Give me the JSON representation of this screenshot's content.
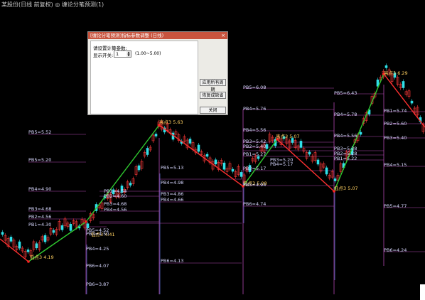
{
  "titlebar": {
    "text": "某股份(日线 前复权) ◎ 缠论分笔预测(1)"
  },
  "dialog": {
    "title": "[缠论分笔预测]指标参数调整 (日线)",
    "close": "×",
    "heading": "请设置计算参数:",
    "param_label": "显示开关:",
    "param_value": "1",
    "param_range": "(1.00~5.00)",
    "apply_all": "应用所有周期",
    "restore_default": "恢复成缺省",
    "close_button": "关闭"
  },
  "colors": {
    "up": "#ff3a3a",
    "down": "#2fe0e8",
    "up_leg": "#2fc82f",
    "down_leg": "#ff3030",
    "label": "#d8d8ff",
    "purple": "#b048b0",
    "dotted": "#b0b0ff",
    "point": "#ff2020"
  },
  "chart": {
    "turning_points": [
      {
        "text": "低点3 4.19"
      },
      {
        "text": "低点3 4.41"
      },
      {
        "text": "高点3 5.63"
      },
      {
        "text": "低点3 5.08"
      },
      {
        "text": "高点3 5.07"
      },
      {
        "text": "低点3 5.07"
      },
      {
        "text": "高点3 6.29"
      }
    ],
    "levels": [
      {
        "text": "PB5=5.52"
      },
      {
        "text": "PB5=5.20"
      },
      {
        "text": "PB4=4.90"
      },
      {
        "text": "PB3=4.68"
      },
      {
        "text": "PB2=4.56"
      },
      {
        "text": "PB1=4.30"
      },
      {
        "text": "PB4=4.25"
      },
      {
        "text": "PB6=4.07"
      },
      {
        "text": "PB6=3.87"
      },
      {
        "text": "PB1=4.54"
      },
      {
        "text": "PB2=4.60"
      },
      {
        "text": "PB3=4.68"
      },
      {
        "text": "PB4=4.56"
      },
      {
        "text": "PB5=4.52"
      },
      {
        "text": "PB3=4.50"
      },
      {
        "text": "PB5=5.13"
      },
      {
        "text": "PB4=4.98"
      },
      {
        "text": "PB3=4.86"
      },
      {
        "text": "PB4=4.66"
      },
      {
        "text": "PB6=4.13"
      },
      {
        "text": "PB5=6.08"
      },
      {
        "text": "PB4=5.76"
      },
      {
        "text": "PB4=5.56"
      },
      {
        "text": "PB3=5.42"
      },
      {
        "text": "PB2=5.40"
      },
      {
        "text": "PB1=5.27"
      },
      {
        "text": "PB3=5.17"
      },
      {
        "text": "PB5=4.94"
      },
      {
        "text": "PB6=4.74"
      },
      {
        "text": "PB3=5.20"
      },
      {
        "text": "PB4=5.17"
      },
      {
        "text": "PB5=6.43"
      },
      {
        "text": "PB4=5.78"
      },
      {
        "text": "PB4=5.56"
      },
      {
        "text": "PB3=5.38"
      },
      {
        "text": "PB2=5.28"
      },
      {
        "text": "PB1=5.22"
      },
      {
        "text": "PB1=5.74"
      },
      {
        "text": "PB2=5.60"
      },
      {
        "text": "PB3=5.40"
      },
      {
        "text": "PB4=5.15"
      },
      {
        "text": "PB5=4.77"
      },
      {
        "text": "PB6=4.24"
      }
    ]
  }
}
